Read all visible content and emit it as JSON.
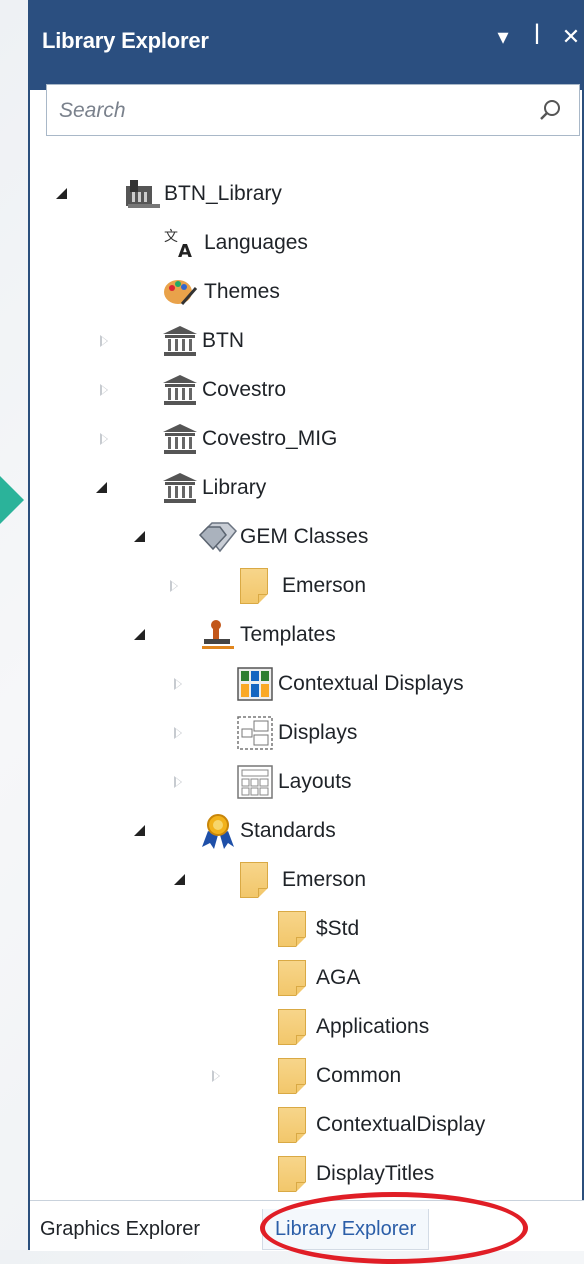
{
  "window": {
    "title": "Library Explorer",
    "controls": {
      "dropdown_glyph": "▾",
      "pin_glyph": "ꟾ",
      "close_glyph": "✕"
    }
  },
  "search": {
    "placeholder": "Search"
  },
  "tree": [
    {
      "label": "BTN_Library",
      "state": "expanded",
      "icon": "library-building-icon"
    },
    {
      "label": "Languages",
      "state": "leaf",
      "icon": "languages-icon"
    },
    {
      "label": "Themes",
      "state": "leaf",
      "icon": "palette-icon"
    },
    {
      "label": "BTN",
      "state": "collapsed",
      "icon": "museum-icon"
    },
    {
      "label": "Covestro",
      "state": "collapsed",
      "icon": "museum-icon"
    },
    {
      "label": "Covestro_MIG",
      "state": "collapsed",
      "icon": "museum-icon"
    },
    {
      "label": "Library",
      "state": "expanded",
      "icon": "museum-icon"
    },
    {
      "label": "GEM Classes",
      "state": "expanded",
      "icon": "gem-icon"
    },
    {
      "label": "Emerson",
      "state": "collapsed",
      "icon": "folder-icon"
    },
    {
      "label": "Templates",
      "state": "expanded",
      "icon": "stamp-icon"
    },
    {
      "label": "Contextual Displays",
      "state": "collapsed",
      "icon": "contextual-displays-icon"
    },
    {
      "label": "Displays",
      "state": "collapsed",
      "icon": "displays-icon"
    },
    {
      "label": "Layouts",
      "state": "collapsed",
      "icon": "layouts-icon"
    },
    {
      "label": "Standards",
      "state": "expanded",
      "icon": "award-icon"
    },
    {
      "label": "Emerson",
      "state": "expanded",
      "icon": "folder-icon"
    },
    {
      "label": "$Std",
      "state": "leaf",
      "icon": "folder-icon"
    },
    {
      "label": "AGA",
      "state": "leaf",
      "icon": "folder-icon"
    },
    {
      "label": "Applications",
      "state": "leaf",
      "icon": "folder-icon"
    },
    {
      "label": "Common",
      "state": "collapsed",
      "icon": "folder-icon"
    },
    {
      "label": "ContextualDisplay",
      "state": "leaf",
      "icon": "folder-icon"
    },
    {
      "label": "DisplayTitles",
      "state": "leaf",
      "icon": "folder-icon"
    }
  ],
  "tabs": {
    "graphics": "Graphics Explorer",
    "library": "Library Explorer",
    "active": "Library Explorer"
  },
  "colors": {
    "titlebar": "#2b4f80",
    "highlight_circle": "#e01e26",
    "pointer": "#2bb39a",
    "active_tab_text": "#2b5ea8"
  }
}
